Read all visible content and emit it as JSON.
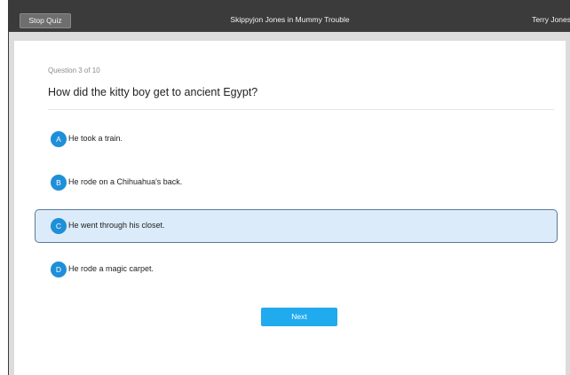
{
  "topbar": {
    "stop_label": "Stop Quiz",
    "title": "Skippyjon Jones in Mummy Trouble",
    "user_name": "Terry Jones"
  },
  "quiz": {
    "progress": "Question 3 of 10",
    "question": "How did the kitty boy get to ancient Egypt?",
    "options": [
      {
        "letter": "A",
        "text": "He took a train.",
        "selected": false
      },
      {
        "letter": "B",
        "text": "He rode on a Chihuahua's back.",
        "selected": false
      },
      {
        "letter": "C",
        "text": "He went through his closet.",
        "selected": true
      },
      {
        "letter": "D",
        "text": "He rode a magic carpet.",
        "selected": false
      }
    ],
    "next_label": "Next"
  },
  "colors": {
    "accent": "#1e8fd8",
    "next_button": "#22aaee",
    "selected_bg": "#dcebf9",
    "topbar_bg": "#3b3b3b"
  }
}
